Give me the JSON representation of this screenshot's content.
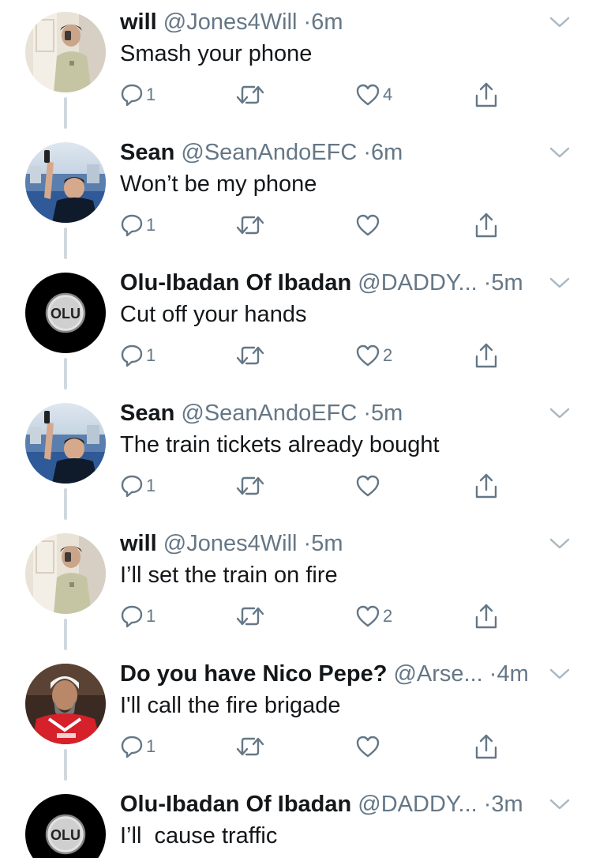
{
  "colors": {
    "text_primary": "#14171a",
    "text_secondary": "#657786",
    "thread_line": "#cfd9de",
    "icon": "#657786"
  },
  "tweets": [
    {
      "name": "will",
      "handle": "@Jones4Will",
      "separator": "·",
      "time": "6m",
      "text": "Smash your phone",
      "reply_count": "1",
      "like_count": "4",
      "avatar": "selfie-avatar"
    },
    {
      "name": "Sean",
      "handle": "@SeanAndoEFC",
      "separator": "·",
      "time": "6m",
      "text": "Won’t be my phone",
      "reply_count": "1",
      "like_count": "",
      "avatar": "stadium-avatar"
    },
    {
      "name": "Olu-Ibadan Of Ibadan",
      "handle": "@DADDY...",
      "separator": "·",
      "time": "5m",
      "text": "Cut off your hands",
      "reply_count": "1",
      "like_count": "2",
      "avatar": "olu-avatar",
      "avatar_text": "OLU"
    },
    {
      "name": "Sean",
      "handle": "@SeanAndoEFC",
      "separator": "·",
      "time": "5m",
      "text": "The train tickets already bought",
      "reply_count": "1",
      "like_count": "",
      "avatar": "stadium-avatar"
    },
    {
      "name": "will",
      "handle": "@Jones4Will",
      "separator": "·",
      "time": "5m",
      "text": "I’ll set the train on fire",
      "reply_count": "1",
      "like_count": "2",
      "avatar": "selfie-avatar"
    },
    {
      "name": "Do you have Nico Pepe?",
      "handle": "@Arse...",
      "separator": "·",
      "time": "4m",
      "text": "I'll call the fire brigade",
      "reply_count": "1",
      "like_count": "",
      "avatar": "red-shirt-avatar"
    },
    {
      "name": "Olu-Ibadan Of Ibadan",
      "handle": "@DADDY...",
      "separator": "·",
      "time": "3m",
      "text": "I’ll  cause traffic",
      "reply_count": "",
      "like_count": "",
      "avatar": "olu-avatar",
      "avatar_text": "OLU"
    }
  ],
  "icons": {
    "reply": "reply-icon",
    "retweet": "retweet-icon",
    "like": "heart-icon",
    "share": "share-icon",
    "more": "chevron-down-icon"
  }
}
